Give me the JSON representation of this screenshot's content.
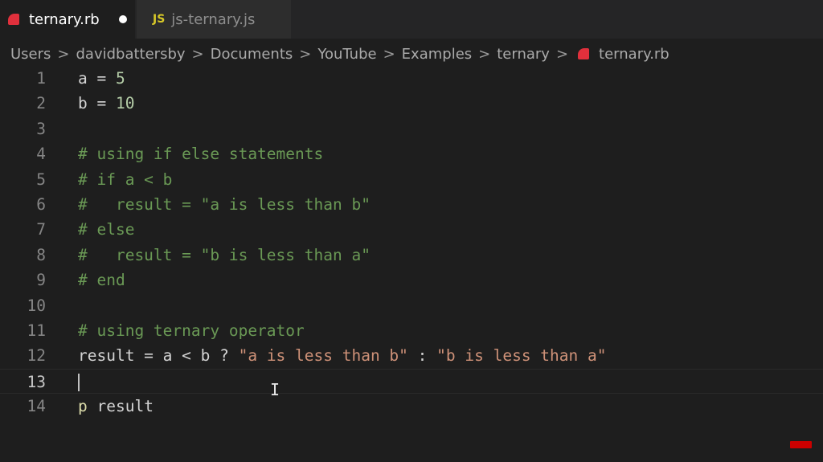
{
  "tabs": [
    {
      "label": "ternary.rb",
      "icon": "ruby-icon",
      "active": true,
      "unsaved": true
    },
    {
      "label": "js-ternary.js",
      "icon": "js-icon",
      "icon_text": "JS",
      "active": false
    }
  ],
  "breadcrumb": [
    "Users",
    "davidbattersby",
    "Documents",
    "YouTube",
    "Examples",
    "ternary",
    "ternary.rb"
  ],
  "breadcrumb_separator": ">",
  "editor": {
    "current_line": 13,
    "lines": [
      {
        "n": "1",
        "tokens": [
          [
            "plain",
            "a = "
          ],
          [
            "num",
            "5"
          ]
        ]
      },
      {
        "n": "2",
        "tokens": [
          [
            "plain",
            "b = "
          ],
          [
            "num",
            "10"
          ]
        ]
      },
      {
        "n": "3",
        "tokens": []
      },
      {
        "n": "4",
        "tokens": [
          [
            "cmt",
            "# using if else statements"
          ]
        ]
      },
      {
        "n": "5",
        "tokens": [
          [
            "cmt",
            "# if a < b"
          ]
        ]
      },
      {
        "n": "6",
        "tokens": [
          [
            "cmt",
            "#   result = \"a is less than b\""
          ]
        ]
      },
      {
        "n": "7",
        "tokens": [
          [
            "cmt",
            "# else"
          ]
        ]
      },
      {
        "n": "8",
        "tokens": [
          [
            "cmt",
            "#   result = \"b is less than a\""
          ]
        ]
      },
      {
        "n": "9",
        "tokens": [
          [
            "cmt",
            "# end"
          ]
        ]
      },
      {
        "n": "10",
        "tokens": []
      },
      {
        "n": "11",
        "tokens": [
          [
            "cmt",
            "# using ternary operator"
          ]
        ]
      },
      {
        "n": "12",
        "tokens": [
          [
            "plain",
            "result = a < b ? "
          ],
          [
            "str",
            "\"a is less than b\""
          ],
          [
            "plain",
            " : "
          ],
          [
            "str",
            "\"b is less than a\""
          ]
        ]
      },
      {
        "n": "13",
        "tokens": []
      },
      {
        "n": "14",
        "tokens": [
          [
            "kw",
            "p"
          ],
          [
            "plain",
            " result"
          ]
        ]
      }
    ]
  },
  "colors": {
    "ruby": "#e0303c",
    "js": "#d7c828",
    "comment": "#6a9955",
    "string": "#ce9178",
    "number": "#b5cea8"
  }
}
